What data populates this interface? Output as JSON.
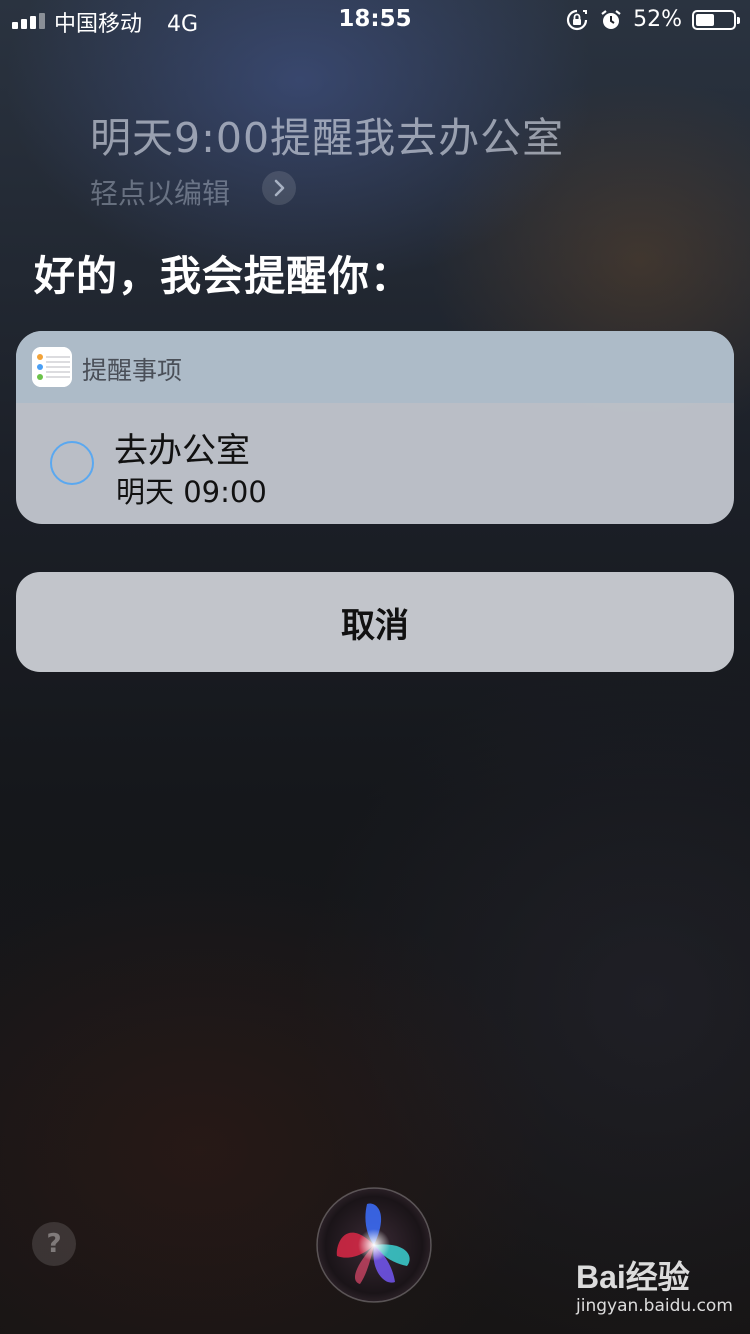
{
  "status_bar": {
    "carrier": "中国移动",
    "network": "4G",
    "time": "18:55",
    "battery_percent": "52%",
    "battery_level": 0.52,
    "icons": [
      "orientation-lock-icon",
      "alarm-icon"
    ]
  },
  "siri": {
    "query": "明天9:00提醒我去办公室",
    "edit_hint": "轻点以编辑",
    "reply": "好的，我会提醒你："
  },
  "reminder_card": {
    "app_name": "提醒事项",
    "item_title": "去办公室",
    "item_time": "明天 09:00",
    "check_color": "#5aa8f0"
  },
  "cancel_label": "取消",
  "help_label": "?",
  "watermark": {
    "logo": "Bai经验",
    "url": "jingyan.baidu.com"
  }
}
